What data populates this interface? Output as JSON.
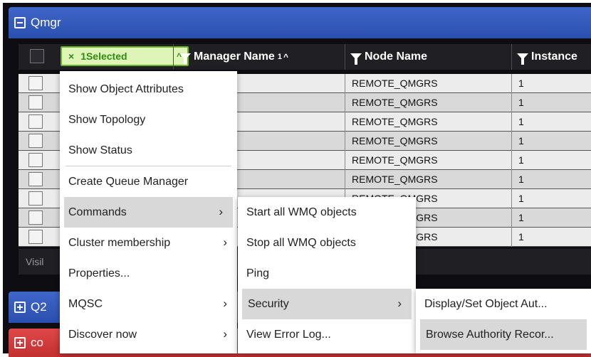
{
  "panel": {
    "title": "Qmgr"
  },
  "grid": {
    "selection_label": "1Selected",
    "selection_x": "×",
    "selection_caret": "^",
    "columns": {
      "manager_name": "Manager Name",
      "manager_sort_index": "1",
      "manager_sort_caret": "^",
      "node_name": "Node Name",
      "instance": "Instance"
    },
    "rows": [
      {
        "node": "REMOTE_QMGRS",
        "instance": "1"
      },
      {
        "node": "REMOTE_QMGRS",
        "instance": "1"
      },
      {
        "node": "REMOTE_QMGRS",
        "instance": "1"
      },
      {
        "node": "REMOTE_QMGRS",
        "instance": "1"
      },
      {
        "node": "REMOTE_QMGRS",
        "instance": "1"
      },
      {
        "node": "REMOTE_QMGRS",
        "instance": "1"
      },
      {
        "node": "REMOTE_QMGRS",
        "instance": "1"
      },
      {
        "node": "REMOTE_QMGRS",
        "instance": "1"
      },
      {
        "node": "REMOTE_QMGRS",
        "instance": "1"
      }
    ],
    "footer_text": "Visil"
  },
  "panel2": {
    "title": "Q2"
  },
  "panel3": {
    "title": "co"
  },
  "context_menu": {
    "items": [
      "Show Object Attributes",
      "Show Topology",
      "Show Status",
      "Create Queue Manager",
      "Commands",
      "Cluster membership",
      "Properties...",
      "MQSC",
      "Discover now"
    ]
  },
  "commands_menu": {
    "items": [
      "Start all WMQ objects",
      "Stop all WMQ objects",
      "Ping",
      "Security",
      "View Error Log..."
    ]
  },
  "security_menu": {
    "items": [
      "Display/Set Object Aut...",
      "Browse Authority Recor..."
    ]
  },
  "icons": {
    "chevron": "›",
    "collapse": "minus-box",
    "expand": "plus-box",
    "filter": "funnel"
  },
  "colors": {
    "header_blue": "#2a4fae",
    "selection_green": "#6bb32a",
    "danger_red": "#c23030"
  }
}
